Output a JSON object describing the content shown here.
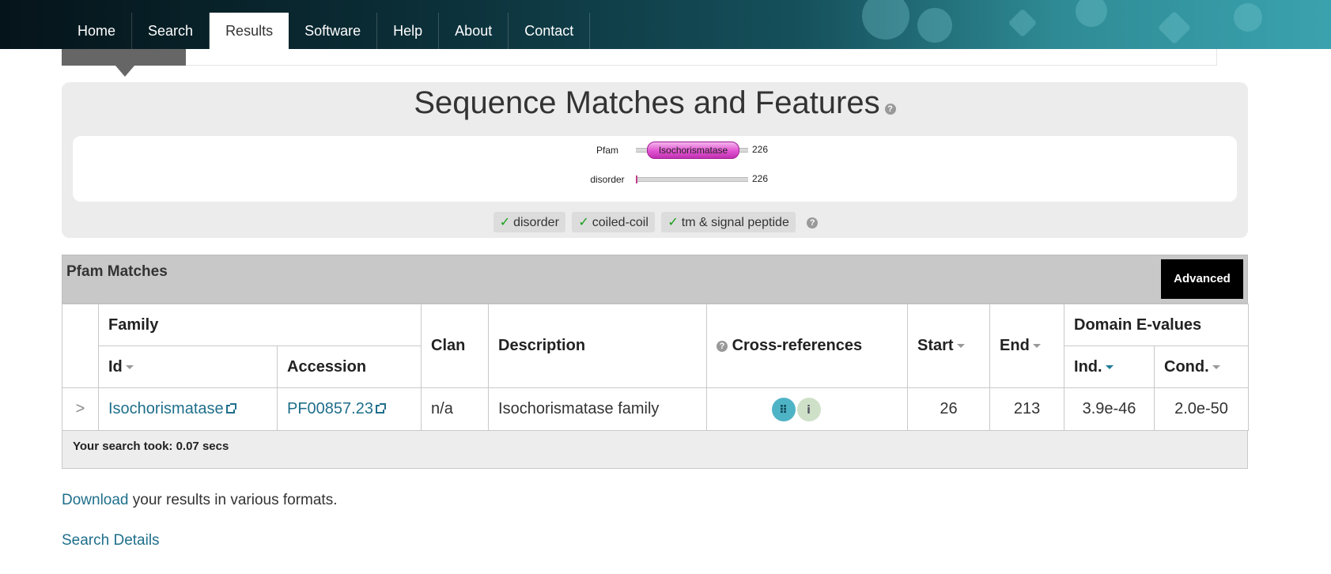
{
  "nav": {
    "items": [
      {
        "label": "Home"
      },
      {
        "label": "Search"
      },
      {
        "label": "Results",
        "active": true
      },
      {
        "label": "Software"
      },
      {
        "label": "Help"
      },
      {
        "label": "About"
      },
      {
        "label": "Contact"
      }
    ]
  },
  "features": {
    "title": "Sequence Matches and Features",
    "tracks": {
      "pfam_label": "Pfam",
      "pfam_domain": "Isochorismatase",
      "pfam_length": "226",
      "disorder_label": "disorder",
      "disorder_length": "226"
    },
    "toggles": [
      {
        "label": "disorder",
        "checked": true
      },
      {
        "label": "coiled-coil",
        "checked": true
      },
      {
        "label": "tm & signal peptide",
        "checked": true
      }
    ]
  },
  "matches": {
    "title": "Pfam Matches",
    "advanced_label": "Advanced",
    "headers": {
      "family": "Family",
      "id": "Id",
      "accession": "Accession",
      "clan": "Clan",
      "description": "Description",
      "cross_references": "Cross-references",
      "start": "Start",
      "end": "End",
      "domain_evalues": "Domain E-values",
      "ind": "Ind.",
      "cond": "Cond."
    },
    "rows": [
      {
        "expand": ">",
        "id": "Isochorismatase",
        "accession": "PF00857.23",
        "clan": "n/a",
        "description": "Isochorismatase family",
        "start": "26",
        "end": "213",
        "ind": "3.9e-46",
        "cond": "2.0e-50"
      }
    ],
    "search_time": "Your search took: 0.07 secs"
  },
  "footer": {
    "download_link": "Download",
    "download_text": " your results in various formats.",
    "search_details": "Search Details"
  },
  "icons": {
    "help": "help-icon",
    "external": "external-link-icon",
    "xref_a": "structure-icon",
    "xref_b": "sequence-icon"
  },
  "colors": {
    "link": "#1f6f8b",
    "domain": "#e459d4",
    "check": "#1a9e1a"
  }
}
